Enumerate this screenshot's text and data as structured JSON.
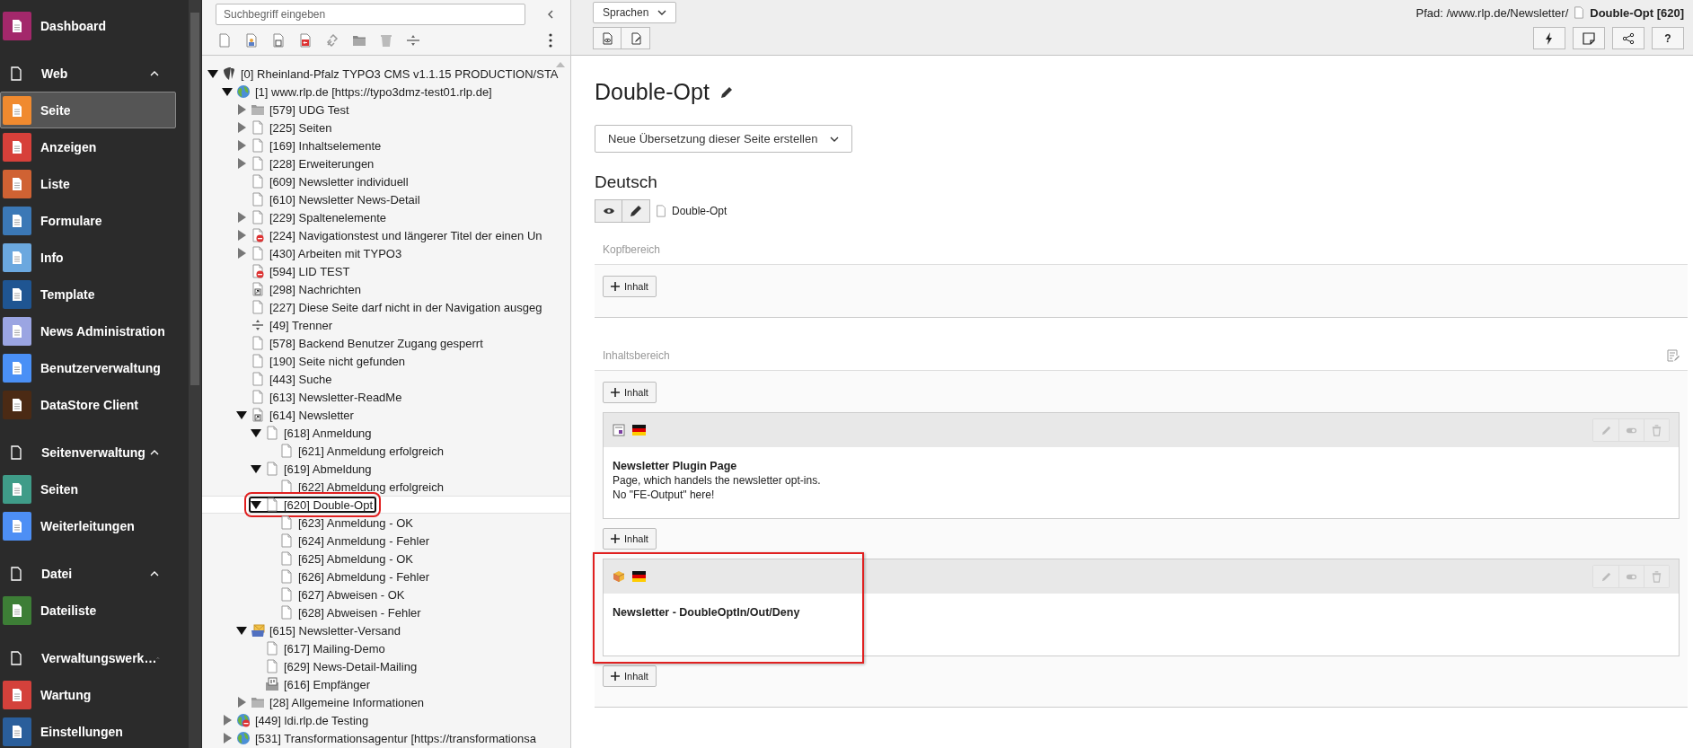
{
  "sidebar": {
    "modules": [
      {
        "kind": "item",
        "label": "Dashboard",
        "color": "#a3286b",
        "selected": false
      },
      {
        "kind": "group",
        "label": "Web",
        "expanded": true,
        "children": [
          {
            "kind": "item",
            "label": "Seite",
            "color": "#f08a2f",
            "selected": true
          },
          {
            "kind": "item",
            "label": "Anzeigen",
            "color": "#d7403a",
            "selected": false
          },
          {
            "kind": "item",
            "label": "Liste",
            "color": "#d06233",
            "selected": false
          },
          {
            "kind": "item",
            "label": "Formulare",
            "color": "#3b78b6",
            "selected": false
          },
          {
            "kind": "item",
            "label": "Info",
            "color": "#6ba8df",
            "selected": false
          },
          {
            "kind": "item",
            "label": "Template",
            "color": "#1f5592",
            "selected": false
          },
          {
            "kind": "item",
            "label": "News Administration",
            "color": "#9ba5e2",
            "selected": false
          },
          {
            "kind": "item",
            "label": "Benutzerverwaltung",
            "color": "#4a90f6",
            "selected": false
          },
          {
            "kind": "item",
            "label": "DataStore Client",
            "color": "#4b2a14",
            "selected": false
          }
        ]
      },
      {
        "kind": "group",
        "label": "Seitenverwaltung",
        "expanded": true,
        "children": [
          {
            "kind": "item",
            "label": "Seiten",
            "color": "#3f9c88",
            "selected": false
          },
          {
            "kind": "item",
            "label": "Weiterleitungen",
            "color": "#4d8ff5",
            "selected": false
          }
        ]
      },
      {
        "kind": "group",
        "label": "Datei",
        "expanded": true,
        "children": [
          {
            "kind": "item",
            "label": "Dateiliste",
            "color": "#3d7e36",
            "selected": false
          }
        ]
      },
      {
        "kind": "group",
        "label": "Verwaltungswerk…",
        "expanded": true,
        "children": [
          {
            "kind": "item",
            "label": "Wartung",
            "color": "#d4413b",
            "selected": false
          },
          {
            "kind": "item",
            "label": "Einstellungen",
            "color": "#2a5e9b",
            "selected": false
          }
        ]
      }
    ]
  },
  "tree": {
    "search": {
      "placeholder": "Suchbegriff eingeben"
    },
    "nodes": [
      {
        "label": "[0] Rheinland-Pfalz TYPO3 CMS v1.1.15 PRODUCTION/STA",
        "kind": "root",
        "hidden": false,
        "selected": false,
        "expanded": true,
        "children": [
          {
            "label": "[1] www.rlp.de [https://typo3dmz-test01.rlp.de]",
            "kind": "site",
            "hidden": false,
            "selected": false,
            "expanded": true,
            "children": [
              {
                "label": "[579] UDG Test",
                "kind": "folder",
                "hidden": false,
                "selected": false,
                "expanded": false
              },
              {
                "label": "[225] Seiten",
                "kind": "page",
                "hidden": false,
                "selected": false,
                "expanded": false
              },
              {
                "label": "[169] Inhaltselemente",
                "kind": "page",
                "hidden": false,
                "selected": false,
                "expanded": false
              },
              {
                "label": "[228] Erweiterungen",
                "kind": "page",
                "hidden": false,
                "selected": false,
                "expanded": false
              },
              {
                "label": "[609] Newsletter individuell",
                "kind": "page",
                "hidden": false,
                "selected": false
              },
              {
                "label": "[610] Newsletter News-Detail",
                "kind": "page",
                "hidden": false,
                "selected": false
              },
              {
                "label": "[229] Spaltenelemente",
                "kind": "page",
                "hidden": false,
                "selected": false,
                "expanded": false
              },
              {
                "label": "[224] Navigationstest und längerer Titel der einen Un",
                "kind": "page",
                "hidden": true,
                "selected": false,
                "expanded": false
              },
              {
                "label": "[430] Arbeiten mit TYPO3",
                "kind": "page",
                "hidden": false,
                "selected": false,
                "expanded": false
              },
              {
                "label": "[594] LID TEST",
                "kind": "page",
                "hidden": true,
                "selected": false
              },
              {
                "label": "[298] Nachrichten",
                "kind": "shortcut",
                "hidden": false,
                "selected": false
              },
              {
                "label": "[227] Diese Seite darf nicht in der Navigation ausgeg",
                "kind": "page",
                "hidden": false,
                "selected": false
              },
              {
                "label": "[49] Trenner",
                "kind": "separator",
                "hidden": false,
                "selected": false
              },
              {
                "label": "[578] Backend Benutzer Zugang gesperrt",
                "kind": "page",
                "hidden": false,
                "selected": false
              },
              {
                "label": "[190] Seite nicht gefunden",
                "kind": "page",
                "hidden": false,
                "selected": false
              },
              {
                "label": "[443] Suche",
                "kind": "page",
                "hidden": false,
                "selected": false
              },
              {
                "label": "[613] Newsletter-ReadMe",
                "kind": "page",
                "hidden": false,
                "selected": false
              },
              {
                "label": "[614] Newsletter",
                "kind": "shortcut",
                "hidden": false,
                "selected": false,
                "expanded": true,
                "children": [
                  {
                    "label": "[618] Anmeldung",
                    "kind": "page",
                    "hidden": false,
                    "selected": false,
                    "expanded": true,
                    "children": [
                      {
                        "label": "[621] Anmeldung erfolgreich",
                        "kind": "page",
                        "hidden": false,
                        "selected": false
                      }
                    ]
                  },
                  {
                    "label": "[619] Abmeldung",
                    "kind": "page",
                    "hidden": false,
                    "selected": false,
                    "expanded": true,
                    "children": [
                      {
                        "label": "[622] Abmeldung erfolgreich",
                        "kind": "page",
                        "hidden": false,
                        "selected": false
                      }
                    ]
                  },
                  {
                    "label": "[620] Double-Opt",
                    "kind": "page",
                    "hidden": false,
                    "selected": true,
                    "annotated": true,
                    "expanded": true,
                    "children": [
                      {
                        "label": "[623] Anmeldung - OK",
                        "kind": "page",
                        "hidden": false,
                        "selected": false
                      },
                      {
                        "label": "[624] Anmeldung - Fehler",
                        "kind": "page",
                        "hidden": false,
                        "selected": false
                      },
                      {
                        "label": "[625] Abmeldung - OK",
                        "kind": "page",
                        "hidden": false,
                        "selected": false
                      },
                      {
                        "label": "[626] Abmeldung - Fehler",
                        "kind": "page",
                        "hidden": false,
                        "selected": false
                      },
                      {
                        "label": "[627] Abweisen - OK",
                        "kind": "page",
                        "hidden": false,
                        "selected": false
                      },
                      {
                        "label": "[628] Abweisen - Fehler",
                        "kind": "page",
                        "hidden": false,
                        "selected": false
                      }
                    ]
                  }
                ]
              },
              {
                "label": "[615] Newsletter-Versand",
                "kind": "mailing",
                "hidden": false,
                "selected": false,
                "expanded": true,
                "children": [
                  {
                    "label": "[617] Mailing-Demo",
                    "kind": "page",
                    "hidden": false,
                    "selected": false
                  },
                  {
                    "label": "[629] News-Detail-Mailing",
                    "kind": "page",
                    "hidden": false,
                    "selected": false
                  },
                  {
                    "label": "[616] Empfänger",
                    "kind": "sysfolder",
                    "hidden": false,
                    "selected": false
                  }
                ]
              },
              {
                "label": "[28] Allgemeine Informationen",
                "kind": "folder",
                "hidden": false,
                "selected": false,
                "expanded": false
              }
            ]
          },
          {
            "label": "[449] ldi.rlp.de Testing",
            "kind": "site",
            "hidden": true,
            "selected": false,
            "expanded": false
          },
          {
            "label": "[531] Transformationsagentur [https://transformationsa",
            "kind": "site",
            "hidden": false,
            "selected": false,
            "expanded": false
          }
        ]
      }
    ]
  },
  "content": {
    "language_menu": "Sprachen",
    "path": "Pfad: /www.rlp.de/Newsletter/",
    "page_ref": "Double-Opt [620]",
    "help": "?",
    "title": "Double-Opt",
    "translation_menu": "Neue Übersetzung dieser Seite erstellen",
    "language": "Deutsch",
    "page_name": "Double-Opt",
    "sections": [
      {
        "label": "Kopfbereich",
        "editable": false,
        "items": [
          {
            "kind": "add",
            "label": "Inhalt"
          }
        ]
      },
      {
        "label": "Inhaltsbereich",
        "editable": true,
        "items": [
          {
            "kind": "add",
            "label": "Inhalt"
          },
          {
            "kind": "plugin",
            "title": "Newsletter Plugin Page",
            "lines": [
              "Page, which handels the newsletter opt-ins.",
              "No \"FE-Output\" here!"
            ],
            "annotated": false
          },
          {
            "kind": "add",
            "label": "Inhalt"
          },
          {
            "kind": "extension",
            "title": "Newsletter - DoubleOptIn/Out/Deny",
            "annotated": true
          },
          {
            "kind": "add",
            "label": "Inhalt"
          }
        ]
      }
    ]
  }
}
